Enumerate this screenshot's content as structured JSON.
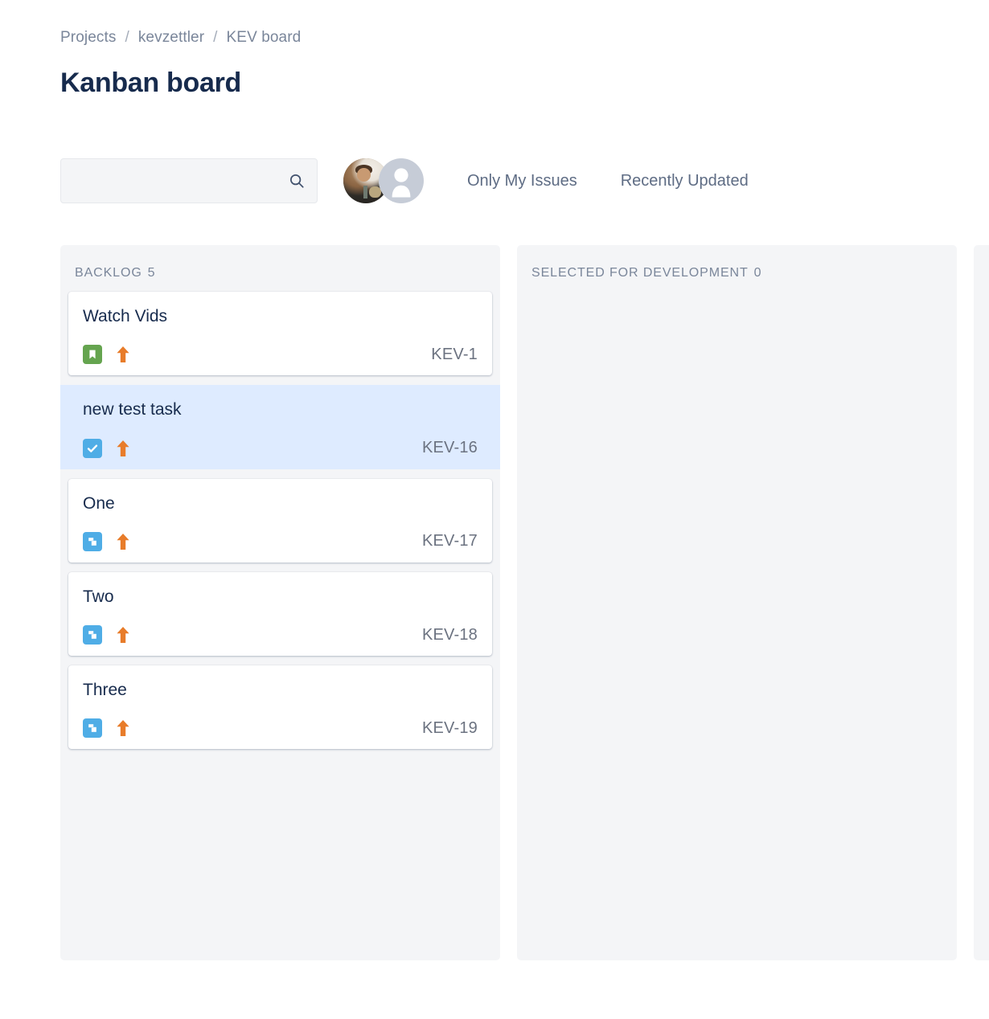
{
  "breadcrumb": {
    "items": [
      {
        "label": "Projects"
      },
      {
        "label": "kevzettler"
      },
      {
        "label": "KEV board"
      }
    ],
    "separator": "/"
  },
  "page_title": "Kanban board",
  "toolbar": {
    "search": {
      "value": "",
      "placeholder": "",
      "icon": "search-icon"
    },
    "avatars": [
      {
        "name": "user-avatar-photo",
        "type": "photo"
      },
      {
        "name": "user-avatar-default",
        "type": "default",
        "icon": "person-icon"
      }
    ],
    "filters": [
      {
        "label": "Only My Issues"
      },
      {
        "label": "Recently Updated"
      }
    ]
  },
  "board": {
    "columns": [
      {
        "title": "BACKLOG",
        "count": "5",
        "cards": [
          {
            "title": "Watch Vids",
            "key": "KEV-1",
            "type": "story",
            "type_icon": "story-bookmark-icon",
            "priority": "high",
            "priority_icon": "arrow-up-icon",
            "selected": false
          },
          {
            "title": "new test task",
            "key": "KEV-16",
            "type": "task",
            "type_icon": "task-checkbox-icon",
            "priority": "high",
            "priority_icon": "arrow-up-icon",
            "selected": true
          },
          {
            "title": "One",
            "key": "KEV-17",
            "type": "subtask",
            "type_icon": "subtask-squares-icon",
            "priority": "high",
            "priority_icon": "arrow-up-icon",
            "selected": false
          },
          {
            "title": "Two",
            "key": "KEV-18",
            "type": "subtask",
            "type_icon": "subtask-squares-icon",
            "priority": "high",
            "priority_icon": "arrow-up-icon",
            "selected": false
          },
          {
            "title": "Three",
            "key": "KEV-19",
            "type": "subtask",
            "type_icon": "subtask-squares-icon",
            "priority": "high",
            "priority_icon": "arrow-up-icon",
            "selected": false
          }
        ]
      },
      {
        "title": "SELECTED FOR DEVELOPMENT",
        "count": "0",
        "cards": []
      },
      {
        "title": "",
        "count": "",
        "cards": []
      }
    ]
  },
  "colors": {
    "accent_blue": "#4fade6",
    "story_green": "#65a44f",
    "priority_orange": "#e87c2a",
    "selected_card_bg": "#deebff",
    "column_bg": "#f4f5f7",
    "text_dark": "#172b4d",
    "text_muted": "#7a869a"
  }
}
